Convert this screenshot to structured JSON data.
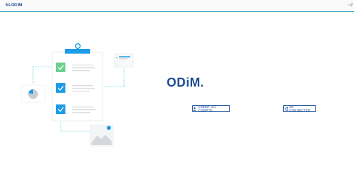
{
  "header": {
    "brand": "SLODIM",
    "lang_marker": "~2"
  },
  "main": {
    "logo_text": "ODiM.",
    "create_account_label": "CRÉER UN COMPTE",
    "login_label": "SE CONNECTER"
  },
  "icons": {
    "user_add": "user-plus-icon",
    "login": "login-icon"
  },
  "colors": {
    "brand": "#1d4d8f",
    "accent": "#2aa1c4",
    "check_green": "#6ccf8f",
    "check_blue": "#1e9be6"
  }
}
